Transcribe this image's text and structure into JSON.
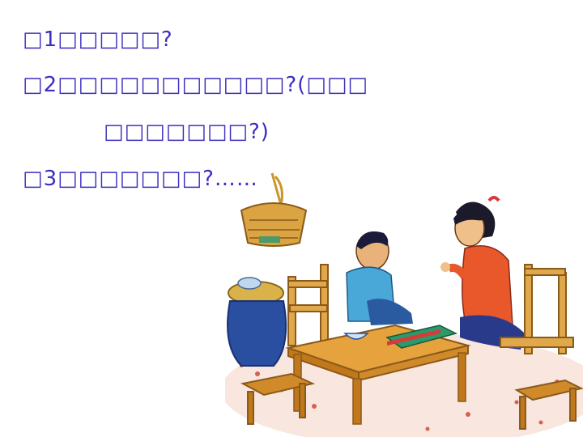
{
  "questions": {
    "q1": "□1□□□□□?",
    "q2": "□2□□□□□□□□□□□?(□□□",
    "q2_cont": "□□□□□□□?)",
    "q3": "□3□□□□□□□?……"
  },
  "illustration": {
    "subject": "mother-and-son-at-table",
    "colors": {
      "mother_shirt": "#e8582b",
      "boy_shirt": "#4aa8d8",
      "table": "#e6a23c",
      "jar": "#2a4fa0",
      "floor": "#c8442a"
    }
  }
}
